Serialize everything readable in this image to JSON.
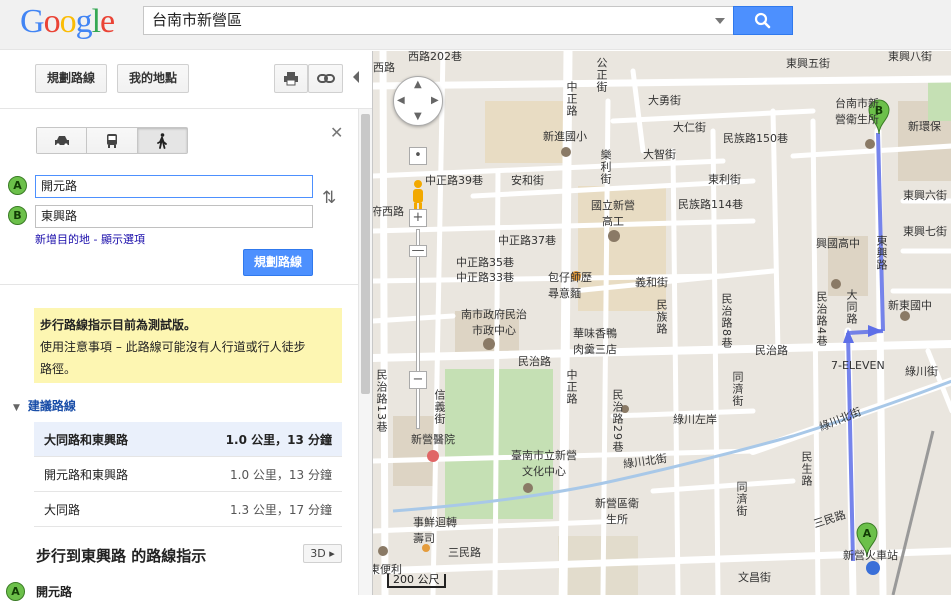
{
  "header": {
    "logo": {
      "letters": [
        "G",
        "o",
        "o",
        "g",
        "l",
        "e"
      ],
      "colors": [
        "#4285f4",
        "#ea4335",
        "#fbbc05",
        "#4285f4",
        "#34a853",
        "#ea4335"
      ]
    },
    "search_value": "台南市新營區",
    "search_icon": "search-icon"
  },
  "toolbar": {
    "directions_label": "規劃路線",
    "my_places_label": "我的地點",
    "print_icon": "print-icon",
    "link_icon": "link-icon"
  },
  "travel_modes": [
    {
      "name": "car-icon",
      "active": false
    },
    {
      "name": "transit-icon",
      "active": false
    },
    {
      "name": "walk-icon",
      "active": true
    }
  ],
  "route": {
    "start_marker": "A",
    "start_value": "開元路",
    "end_marker": "B",
    "end_value": "東興路",
    "add_destination": "新增目的地",
    "separator": " - ",
    "show_options": "顯示選項",
    "plan_button": "規劃路線"
  },
  "notice": {
    "title": "步行路線指示目前為測試版。",
    "line1": "使用注意事項 – 此路線可能沒有人行道或行人徒步",
    "line2": "路徑。"
  },
  "suggested": {
    "title": "建議路線",
    "routes": [
      {
        "name": "大同路和東興路",
        "meta": "1.0 公里，13 分鐘",
        "selected": true
      },
      {
        "name": "開元路和東興路",
        "meta": "1.0 公里，13 分鐘",
        "selected": false
      },
      {
        "name": "大同路",
        "meta": "1.3 公里，17 分鐘",
        "selected": false
      }
    ]
  },
  "directions": {
    "title": "步行到東興路 的路線指示",
    "btn_3d": "3D",
    "first_step_marker": "A",
    "first_step": "開元路"
  },
  "map": {
    "scale": "200 公尺",
    "labels": {
      "l1": "西路202巷",
      "l2": "公正街",
      "l3": "東興五街",
      "l4": "東興八街",
      "l5": "大勇街",
      "l6": "台南市新營衛生所",
      "l7": "新環保",
      "l8": "大仁街",
      "l9": "新進國小",
      "l10": "民族路150巷",
      "l11": "大智街",
      "l12": "樂利街",
      "l13": "安和街",
      "l14": "中正路39巷",
      "l15": "中正路",
      "l16": "東利街",
      "l17": "東興六街",
      "l18": "國立新營高工",
      "l19": "民族路114巷",
      "l20": "東興七街",
      "l21": "府西路",
      "l22": "中正路37巷",
      "l23": "興國高中",
      "l24": "東興路",
      "l25": "中正路35巷",
      "l26": "中正路33巷",
      "l27": "包仔師歷尋意麵",
      "l28": "義和街",
      "l29": "民族路",
      "l30": "大同路",
      "l31": "新東國中",
      "l32": "南市政府民治市政中心",
      "l33": "民治路8巷",
      "l34": "民治路4巷",
      "l35": "華味香鴨肉羹三店",
      "l36": "民治路",
      "l37": "民治路",
      "l38": "7-ELEVEN",
      "l39": "綠川街",
      "l40": "信義街",
      "l41": "中正路",
      "l42": "民治路29巷",
      "l43": "綠川左岸",
      "l44": "同濟街",
      "l45": "綠川北街",
      "l46": "新營醫院",
      "l47": "臺南市立新營文化中心",
      "l48": "綠川北街",
      "l49": "民生路",
      "l50": "新營區衛生所",
      "l51": "事鮮迴轉壽司",
      "l52": "三民路",
      "l53": "同濟街",
      "l54": "三民路",
      "l55": "新營火車站",
      "l56": "東便利",
      "l57": "文昌街",
      "l58": "民治路13巷",
      "l59": "西路"
    },
    "markers": {
      "start": "A",
      "end": "B"
    },
    "route_color": "#5e6fe8",
    "zoom_in": "+",
    "zoom_out": "−"
  }
}
